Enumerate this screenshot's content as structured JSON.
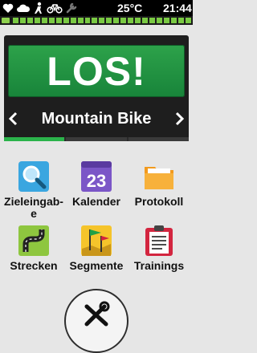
{
  "status_bar": {
    "icons": [
      "heart-icon",
      "cloud-icon",
      "person-icon",
      "bike-icon",
      "wrench-icon"
    ],
    "temperature": "25°C",
    "time": "21:44"
  },
  "battery": {
    "level": 1.0,
    "color": "#7ac943"
  },
  "start": {
    "go_label": "LOS!",
    "activity_profile": "Mountain Bike",
    "profile_progress_active_segments": 1
  },
  "apps": [
    {
      "label": "Zieleingab-\ne",
      "icon": "search-icon"
    },
    {
      "label": "Kalender",
      "icon": "calendar-icon",
      "calendar_day": "23"
    },
    {
      "label": "Protokoll",
      "icon": "folder-icon"
    },
    {
      "label": "Strecken",
      "icon": "route-icon"
    },
    {
      "label": "Segmente",
      "icon": "segment-flag-icon"
    },
    {
      "label": "Trainings",
      "icon": "clipboard-icon"
    }
  ],
  "tools": {
    "icon": "tools-icon"
  },
  "colors": {
    "go": "#1e8f41",
    "accent": "#2bb34b"
  }
}
